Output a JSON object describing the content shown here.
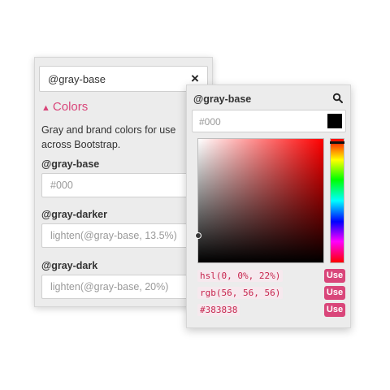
{
  "back_panel": {
    "search_value": "@gray-base",
    "clear_icon": "×",
    "section": {
      "caret": "▲",
      "title": "Colors",
      "description": "Gray and brand colors for use across Bootstrap."
    },
    "variables": [
      {
        "name": "@gray-base",
        "value": "#000"
      },
      {
        "name": "@gray-darker",
        "value": "lighten(@gray-base, 13.5%)"
      },
      {
        "name": "@gray-dark",
        "value": "lighten(@gray-base, 20%)"
      }
    ]
  },
  "picker": {
    "title": "@gray-base",
    "input_value": "#000",
    "preview_color": "#000000",
    "selected_color": "#383838",
    "formats": [
      {
        "value": "hsl(0, 0%, 22%)",
        "button": "Use"
      },
      {
        "value": "rgb(56, 56, 56)",
        "button": "Use"
      },
      {
        "value": "#383838",
        "button": "Use"
      }
    ]
  },
  "colors": {
    "accent": "#d9467a",
    "code_text": "#c7254e"
  },
  "icons": {
    "clear": "close-icon",
    "search": "search-icon"
  }
}
